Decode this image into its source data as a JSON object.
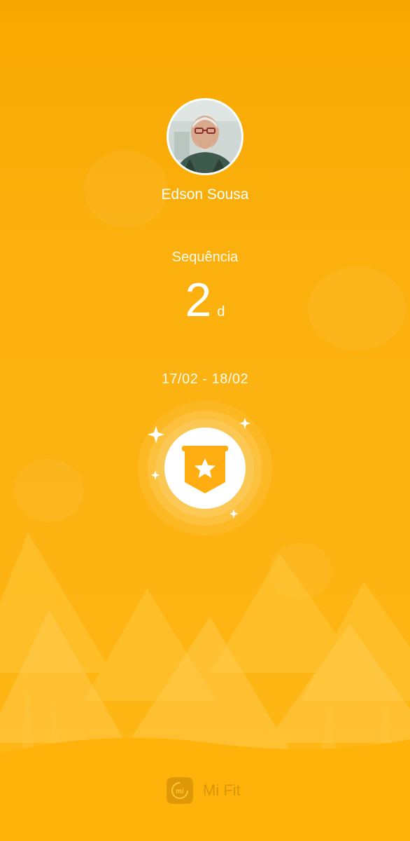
{
  "profile": {
    "name": "Edson Sousa",
    "avatar_icon": "user-avatar"
  },
  "streak": {
    "label": "Sequência",
    "value": "2",
    "unit": "d"
  },
  "period": {
    "range": "17/02 - 18/02"
  },
  "badge": {
    "icon": "star-ribbon-badge-icon"
  },
  "brand": {
    "logo_text": "mi",
    "name": "Mi Fit"
  },
  "colors": {
    "background_top": "#f7a800",
    "background_bottom": "#ffb816",
    "foreground": "#ffffff"
  }
}
